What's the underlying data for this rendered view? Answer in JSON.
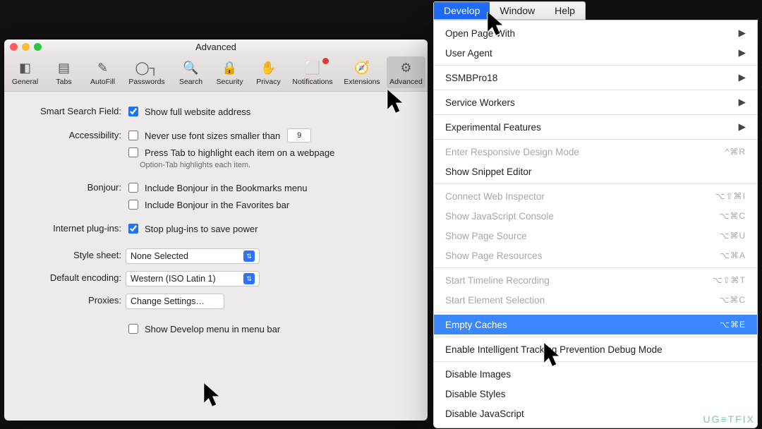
{
  "window": {
    "title": "Advanced"
  },
  "toolbar": {
    "items": [
      {
        "label": "General"
      },
      {
        "label": "Tabs"
      },
      {
        "label": "AutoFill"
      },
      {
        "label": "Passwords"
      },
      {
        "label": "Search"
      },
      {
        "label": "Security"
      },
      {
        "label": "Privacy"
      },
      {
        "label": "Notifications"
      },
      {
        "label": "Extensions"
      },
      {
        "label": "Advanced"
      }
    ]
  },
  "sections": {
    "smart_search": {
      "label": "Smart Search Field:",
      "show_full_url": "Show full website address"
    },
    "accessibility": {
      "label": "Accessibility:",
      "never_font": "Never use font sizes smaller than",
      "font_value": "9",
      "press_tab": "Press Tab to highlight each item on a webpage",
      "hint": "Option-Tab highlights each item."
    },
    "bonjour": {
      "label": "Bonjour:",
      "bookmarks": "Include Bonjour in the Bookmarks menu",
      "favorites": "Include Bonjour in the Favorites bar"
    },
    "plugins": {
      "label": "Internet plug-ins:",
      "stop": "Stop plug-ins to save power"
    },
    "style": {
      "label": "Style sheet:",
      "value": "None Selected"
    },
    "encoding": {
      "label": "Default encoding:",
      "value": "Western (ISO Latin 1)"
    },
    "proxies": {
      "label": "Proxies:",
      "button": "Change Settings…"
    },
    "develop_toggle": "Show Develop menu in menu bar"
  },
  "menubar": {
    "items": [
      "Develop",
      "Window",
      "Help"
    ]
  },
  "develop_menu": {
    "items": [
      {
        "label": "Open Page With",
        "sub": true
      },
      {
        "label": "User Agent",
        "sub": true
      },
      {
        "sep": true
      },
      {
        "label": "SSMBPro18",
        "sub": true
      },
      {
        "sep": true
      },
      {
        "label": "Service Workers",
        "sub": true
      },
      {
        "sep": true
      },
      {
        "label": "Experimental Features",
        "sub": true
      },
      {
        "sep": true
      },
      {
        "label": "Enter Responsive Design Mode",
        "shortcut": "^⌘R",
        "disabled": true
      },
      {
        "label": "Show Snippet Editor"
      },
      {
        "sep": true
      },
      {
        "label": "Connect Web Inspector",
        "shortcut": "⌥⇧⌘I",
        "disabled": true
      },
      {
        "label": "Show JavaScript Console",
        "shortcut": "⌥⌘C",
        "disabled": true
      },
      {
        "label": "Show Page Source",
        "shortcut": "⌥⌘U",
        "disabled": true
      },
      {
        "label": "Show Page Resources",
        "shortcut": "⌥⌘A",
        "disabled": true
      },
      {
        "sep": true
      },
      {
        "label": "Start Timeline Recording",
        "shortcut": "⌥⇧⌘T",
        "disabled": true
      },
      {
        "label": "Start Element Selection",
        "shortcut": "⌥⌘C",
        "disabled": true
      },
      {
        "sep": true
      },
      {
        "label": "Empty Caches",
        "shortcut": "⌥⌘E",
        "highlight": true
      },
      {
        "sep": true
      },
      {
        "label": "Enable Intelligent Tracking Prevention Debug Mode"
      },
      {
        "sep": true
      },
      {
        "label": "Disable Images"
      },
      {
        "label": "Disable Styles"
      },
      {
        "label": "Disable JavaScript"
      }
    ]
  },
  "watermark": "UG≡TFIX"
}
